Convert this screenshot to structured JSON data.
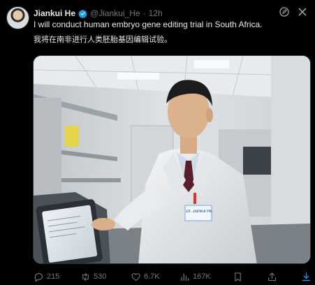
{
  "tweet": {
    "display_name": "Jiankui He",
    "handle": "@Jiankui_He",
    "separator": "·",
    "time": "12h",
    "text_en": "I will conduct human embryo gene editing trial in South Africa.",
    "text_zh": "我将在南非进行人类胚胎基因编辑试验。"
  },
  "media": {
    "badge_text": "Dr. Jiankui He"
  },
  "actions": {
    "replies": "215",
    "retweets": "530",
    "likes": "6.7K",
    "views": "167K"
  },
  "icons": {
    "verified": "verified-badge-icon",
    "edit": "edit-icon",
    "close": "close-icon",
    "reply": "reply-icon",
    "retweet": "retweet-icon",
    "like": "heart-icon",
    "views": "views-icon",
    "bookmark": "bookmark-icon",
    "share": "share-icon",
    "download": "download-icon"
  },
  "colors": {
    "background": "#000000",
    "text": "#e7e9ea",
    "muted": "#71767b",
    "accent": "#1d9bf0"
  }
}
